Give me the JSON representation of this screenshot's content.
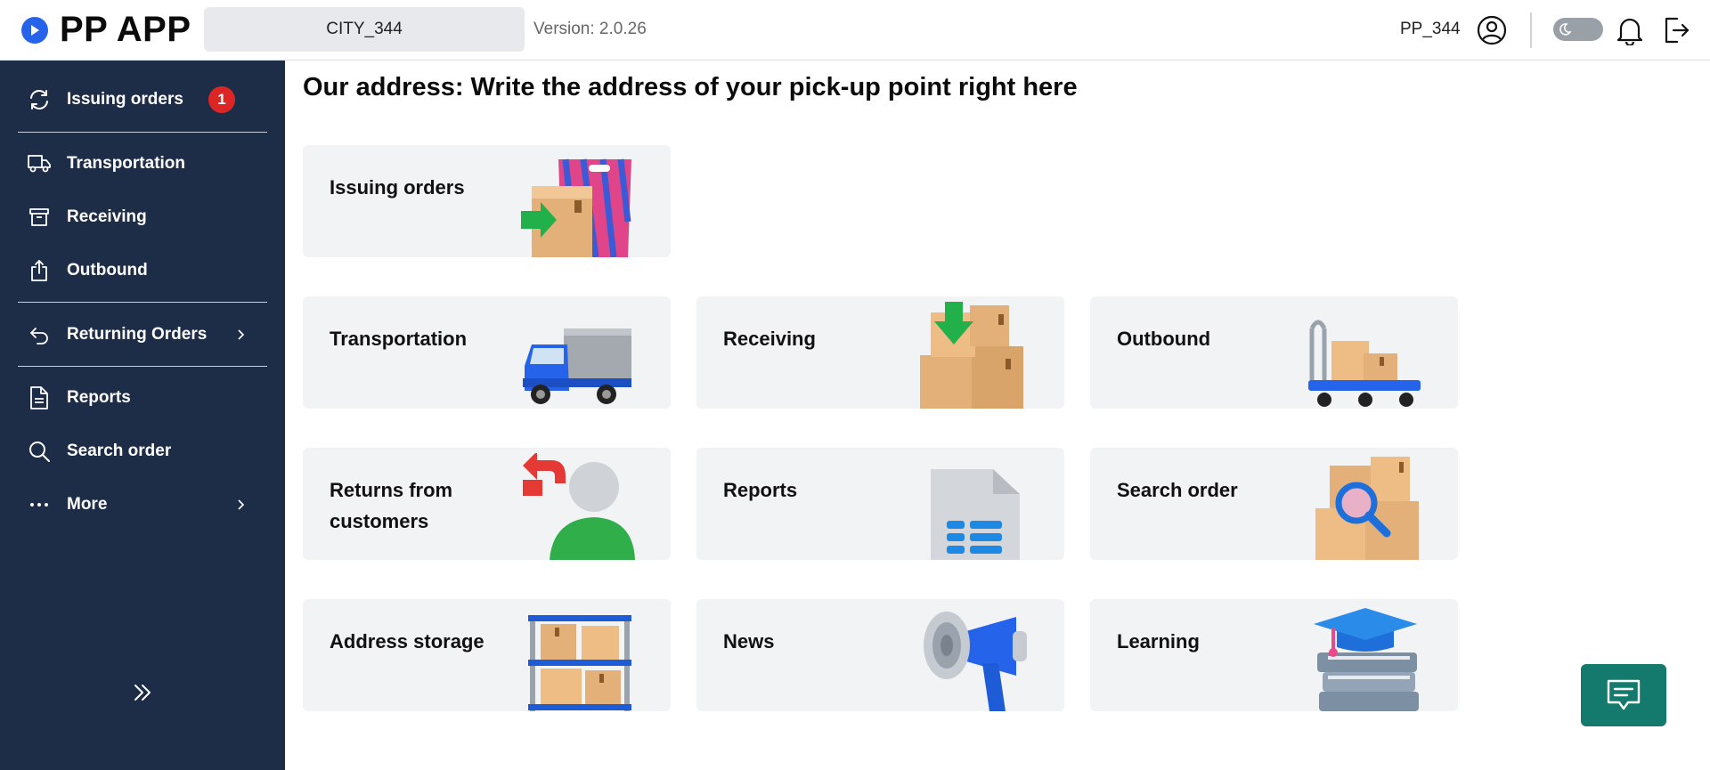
{
  "app": {
    "name": "PP APP",
    "logo_icon": "play-circle-icon"
  },
  "header": {
    "city": "CITY_344",
    "version": "Version: 2.0.26",
    "user": "PP_344",
    "icons": [
      "user-circle-icon",
      "theme-toggle",
      "bell-icon",
      "logout-icon"
    ]
  },
  "sidebar": {
    "items": [
      {
        "label": "Issuing orders",
        "icon": "refresh-icon",
        "badge": "1"
      },
      {
        "label": "Transportation",
        "icon": "truck-icon"
      },
      {
        "label": "Receiving",
        "icon": "archive-box-icon"
      },
      {
        "label": "Outbound",
        "icon": "share-box-icon"
      },
      {
        "label": "Returning Orders",
        "icon": "return-arrow-icon",
        "has_submenu": true
      },
      {
        "label": "Reports",
        "icon": "document-icon"
      },
      {
        "label": "Search order",
        "icon": "search-icon"
      },
      {
        "label": "More",
        "icon": "ellipsis-icon",
        "has_submenu": true
      }
    ],
    "collapse_icon": "double-chevron-right-icon"
  },
  "main": {
    "title": "Our address: Write the address of your pick-up point right here",
    "cards": [
      {
        "label": "Issuing orders",
        "image": "shopping-bag-box-illustration"
      },
      {
        "label": "Transportation",
        "image": "truck-illustration"
      },
      {
        "label": "Receiving",
        "image": "boxes-down-arrow-illustration"
      },
      {
        "label": "Outbound",
        "image": "cart-boxes-illustration"
      },
      {
        "label": "Returns from customers",
        "image": "person-return-illustration"
      },
      {
        "label": "Reports",
        "image": "report-document-illustration"
      },
      {
        "label": "Search order",
        "image": "boxes-magnifier-illustration"
      },
      {
        "label": "Address storage",
        "image": "shelf-boxes-illustration"
      },
      {
        "label": "News",
        "image": "megaphone-illustration"
      },
      {
        "label": "Learning",
        "image": "graduation-books-illustration"
      }
    ]
  },
  "chat": {
    "icon": "chat-bubble-icon"
  },
  "colors": {
    "sidebar": "#1e2d47",
    "accent": "#2563eb",
    "badge": "#dc2626",
    "chat_button": "#137a6d",
    "card_bg": "#f2f3f5"
  }
}
